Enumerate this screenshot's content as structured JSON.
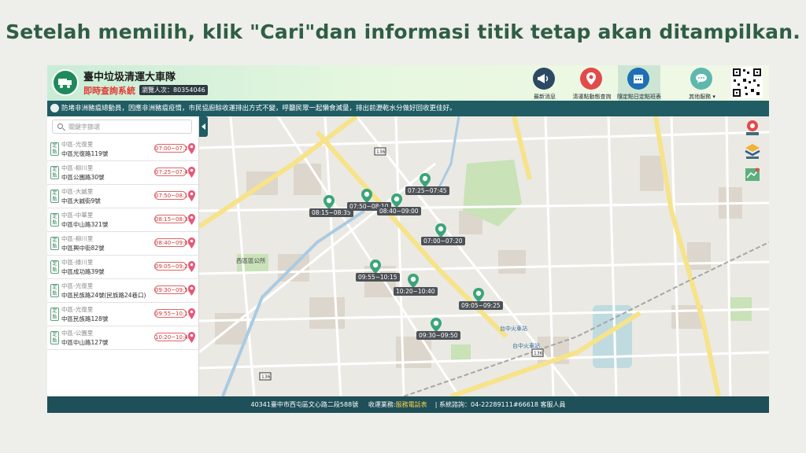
{
  "slide": {
    "title": "Setelah memilih, klik \"Cari\"dan informasi titik tetap  akan ditampilkan."
  },
  "header": {
    "org_name": "臺中垃圾清運大車隊",
    "system_name": "即時查詢系統",
    "visits": "瀏覽人次：80354046",
    "nav": [
      {
        "label": "最新消息",
        "icon": "megaphone-icon",
        "color": "#2d4a63"
      },
      {
        "label": "清運點動態查詢",
        "icon": "location-pin-icon",
        "color": "#e24b4b"
      },
      {
        "label": "隨定點日定點班表",
        "icon": "calendar-icon",
        "color": "#1f6fb4"
      },
      {
        "label": "其他服務 ▾",
        "icon": "chat-bubble-icon",
        "color": "#5fb8ad"
      }
    ]
  },
  "marquee": {
    "text": "防堵非洲豬瘟總動員，因應非洲豬瘟疫情，市民協廚餘收運排出方式不變，呼籲民眾一起懶食減量，排出前瀝乾水分做好回收更佳好。"
  },
  "sidebar": {
    "search_placeholder": "關鍵字篩選",
    "tag": "定點",
    "stops": [
      {
        "district": "中區-光復里",
        "address": "中區光復路119號",
        "time": "07:00~07:20"
      },
      {
        "district": "中區-柳川里",
        "address": "中區公園路30號",
        "time": "07:25~07:45"
      },
      {
        "district": "中區-大誠里",
        "address": "中區大誠街9號",
        "time": "07:50~08:10"
      },
      {
        "district": "中區-中華里",
        "address": "中區中山路321號",
        "time": "08:15~08:35"
      },
      {
        "district": "中區-柳川里",
        "address": "中區興中街82號",
        "time": "08:40~09:00"
      },
      {
        "district": "中區-綠川里",
        "address": "中區成功路39號",
        "time": "09:05~09:25"
      },
      {
        "district": "中區-光復里",
        "address": "中區民族路24號(民族路24巷口)",
        "time": "09:30~09:50"
      },
      {
        "district": "中區-光復里",
        "address": "中區民族路128號",
        "time": "09:55~10:15"
      },
      {
        "district": "中區-公園里",
        "address": "中區中山路127號",
        "time": "10:20~10:40"
      }
    ]
  },
  "map": {
    "markers": [
      "08:15~08:35",
      "07:50~08:10",
      "08:40~09:00",
      "07:25~07:45",
      "07:00~07:20",
      "09:55~10:15",
      "10:20~10:40",
      "09:05~09:25",
      "09:30~09:50"
    ],
    "place_labels": [
      "西區區公所",
      "台中火車站",
      "台中火車站"
    ],
    "road_shields": [
      "136",
      "136",
      "136"
    ]
  },
  "footer": {
    "address": "40341臺中市西屯區文心路二段588號",
    "hours_label": "收運業務:",
    "hours_link": "服務電話表",
    "contact": "| 系統諮詢：04-22289111#66618 客服人員"
  },
  "colors": {
    "brand_dark": "#1f5c63",
    "accent_red": "#e24b4b",
    "title_green": "#2f5e44"
  }
}
